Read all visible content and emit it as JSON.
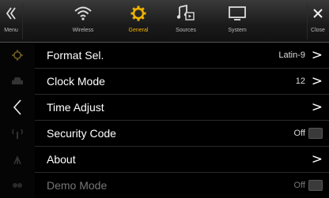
{
  "topbar": {
    "menu_label": "Menu",
    "wireless_label": "Wireless",
    "general_label": "General",
    "sources_label": "Sources",
    "system_label": "System",
    "close_label": "Close"
  },
  "colors": {
    "accent": "#f0b400",
    "background": "#000000"
  },
  "rows": [
    {
      "label": "Format Sel.",
      "value": "Latin-9",
      "control": "chevron"
    },
    {
      "label": "Clock Mode",
      "value": "12",
      "control": "chevron"
    },
    {
      "label": "Time Adjust",
      "value": "",
      "control": "chevron"
    },
    {
      "label": "Security Code",
      "value": "Off",
      "control": "toggle"
    },
    {
      "label": "About",
      "value": "",
      "control": "chevron"
    },
    {
      "label": "Demo Mode",
      "value": "Off",
      "control": "toggle"
    }
  ],
  "chevron": ">",
  "back_glyph": "〈"
}
